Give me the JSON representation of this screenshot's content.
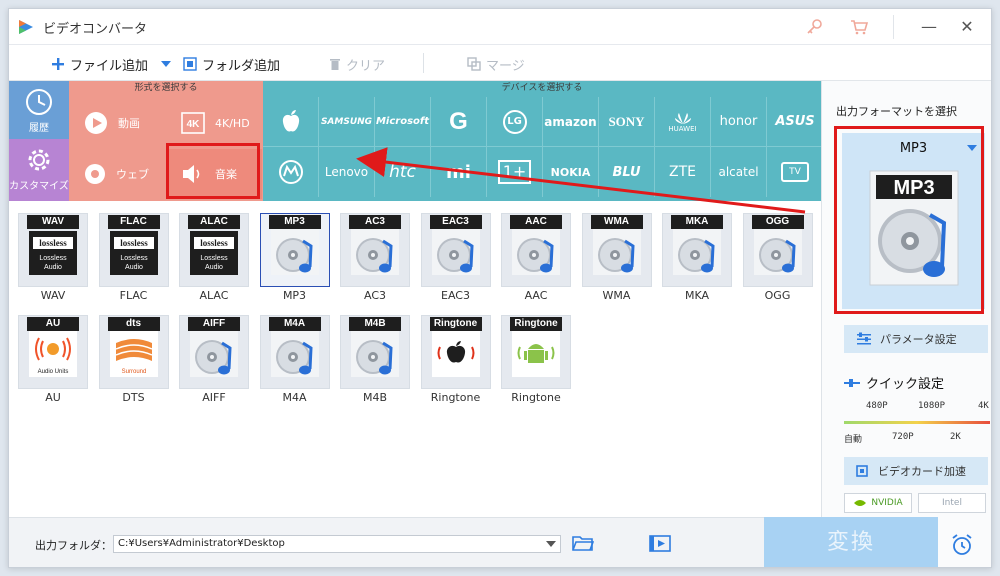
{
  "app": {
    "title": "ビデオコンバータ",
    "colors": {
      "accent": "#2f7de0",
      "format_panel": "#ef9a8d",
      "device_panel": "#5ab8c3",
      "history": "#6a9fd6",
      "custom": "#b784d3",
      "annotation": "#e01a1a"
    }
  },
  "toolbar": {
    "add_file": "ファイル追加",
    "add_folder": "フォルダ追加",
    "clear": "クリア",
    "merge": "マージ"
  },
  "categories": {
    "history": "履歴",
    "custom": "カスタマイズ",
    "format_header": "形式を選択する",
    "device_header": "デバイスを選択する",
    "format_tabs": [
      {
        "label": "動画",
        "icon": "play-icon"
      },
      {
        "label": "4K/HD",
        "icon": "4k-icon"
      },
      {
        "label": "ウェブ",
        "icon": "chrome-icon"
      },
      {
        "label": "音楽",
        "icon": "speaker-icon"
      }
    ],
    "devices_row1": [
      "SAMSUNG",
      "Microsoft",
      "G",
      "LG",
      "amazon",
      "SONY",
      "HUAWEI",
      "honor",
      "ASUS"
    ],
    "devices_row2": [
      "Lenovo",
      "htc",
      "mi",
      "1+",
      "NOKIA",
      "BLU",
      "ZTE",
      "alcatel",
      "TV"
    ]
  },
  "formats": [
    {
      "badge": "WAV",
      "caption": "WAV",
      "kind": "lossless"
    },
    {
      "badge": "FLAC",
      "caption": "FLAC",
      "kind": "lossless"
    },
    {
      "badge": "ALAC",
      "caption": "ALAC",
      "kind": "lossless"
    },
    {
      "badge": "MP3",
      "caption": "MP3",
      "kind": "disc",
      "selected": true
    },
    {
      "badge": "AC3",
      "caption": "AC3",
      "kind": "disc"
    },
    {
      "badge": "EAC3",
      "caption": "EAC3",
      "kind": "disc"
    },
    {
      "badge": "AAC",
      "caption": "AAC",
      "kind": "disc"
    },
    {
      "badge": "WMA",
      "caption": "WMA",
      "kind": "disc"
    },
    {
      "badge": "MKA",
      "caption": "MKA",
      "kind": "disc"
    },
    {
      "badge": "OGG",
      "caption": "OGG",
      "kind": "disc"
    },
    {
      "badge": "AU",
      "caption": "AU",
      "kind": "au"
    },
    {
      "badge": "dts",
      "caption": "DTS",
      "kind": "dts"
    },
    {
      "badge": "AIFF",
      "caption": "AIFF",
      "kind": "disc"
    },
    {
      "badge": "M4A",
      "caption": "M4A",
      "kind": "disc"
    },
    {
      "badge": "M4B",
      "caption": "M4B",
      "kind": "disc"
    },
    {
      "badge": "Ringtone",
      "caption": "Ringtone",
      "kind": "apple"
    },
    {
      "badge": "Ringtone",
      "caption": "Ringtone",
      "kind": "android"
    }
  ],
  "format_art_text": {
    "lossless_logo": "lossless",
    "lossless_sub1": "Lossless",
    "lossless_sub2": "Audio",
    "au_sub": "Audio Units",
    "dts_sub": "Surround"
  },
  "output": {
    "folder_label": "出力フォルダ：",
    "folder_path": "C:¥Users¥Administrator¥Desktop",
    "convert": "変換"
  },
  "right_panel": {
    "title": "出力フォーマットを選択",
    "selected_format": "MP3",
    "param_button": "パラメータ設定",
    "quick_label": "クイック設定",
    "quality_top": [
      "480P",
      "1080P",
      "4K"
    ],
    "quality_bottom": [
      "自動",
      "720P",
      "2K"
    ],
    "gpu_button": "ビデオカード加速",
    "nvidia": "NVIDIA",
    "intel": "Intel"
  }
}
